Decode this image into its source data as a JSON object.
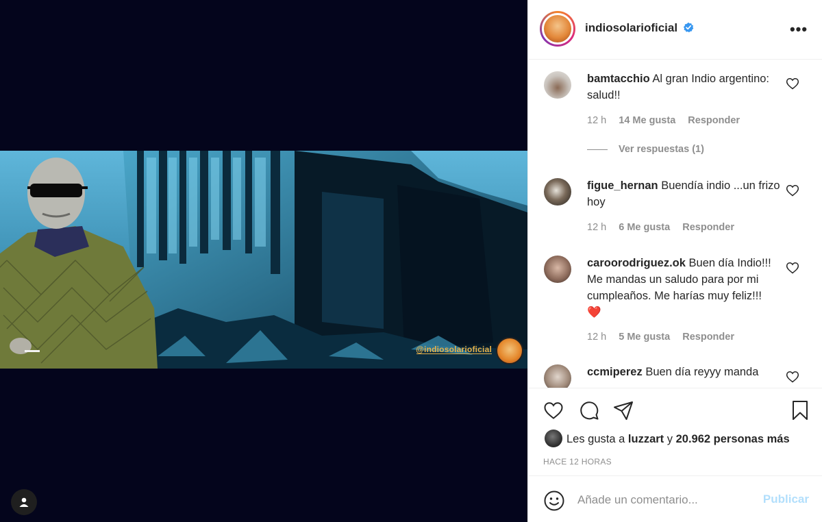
{
  "post": {
    "watermark": "@indiosolarioficial"
  },
  "header": {
    "username": "indiosolarioficial",
    "more_label": "•••"
  },
  "comments": [
    {
      "username": "bamtacchio",
      "text": "Al gran Indio argentino: salud!!",
      "time": "12 h",
      "likes": "14 Me gusta",
      "reply": "Responder",
      "view_replies": "Ver respuestas (1)"
    },
    {
      "username": "figue_hernan",
      "text": "Buendía indio ...un frizo hoy",
      "time": "12 h",
      "likes": "6 Me gusta",
      "reply": "Responder"
    },
    {
      "username": "caroorodriguez.ok",
      "text": "Buen día Indio!!! Me mandas un saludo para por mi cumpleaños. Me harías muy feliz!!!",
      "emoji": "❤️",
      "time": "12 h",
      "likes": "5 Me gusta",
      "reply": "Responder"
    },
    {
      "username": "ccmiperez",
      "text": "Buen día reyyy manda"
    }
  ],
  "likes": {
    "prefix": "Les gusta a",
    "user": "luzzart",
    "joiner": "y",
    "others": "20.962 personas más"
  },
  "time_ago": "HACE 12 HORAS",
  "compose": {
    "placeholder": "Añade un comentario...",
    "publish_label": "Publicar"
  },
  "colors": {
    "media_bg": "#04051c",
    "link_blue_disabled": "#b2dffc",
    "verified_blue": "#3897f0",
    "heart_red": "#ed4956",
    "muted_text": "#8e8e8e"
  },
  "icons": [
    "heart-icon",
    "comment-icon",
    "share-icon",
    "bookmark-icon",
    "emoji-icon",
    "verified-icon",
    "user-tag-icon"
  ]
}
